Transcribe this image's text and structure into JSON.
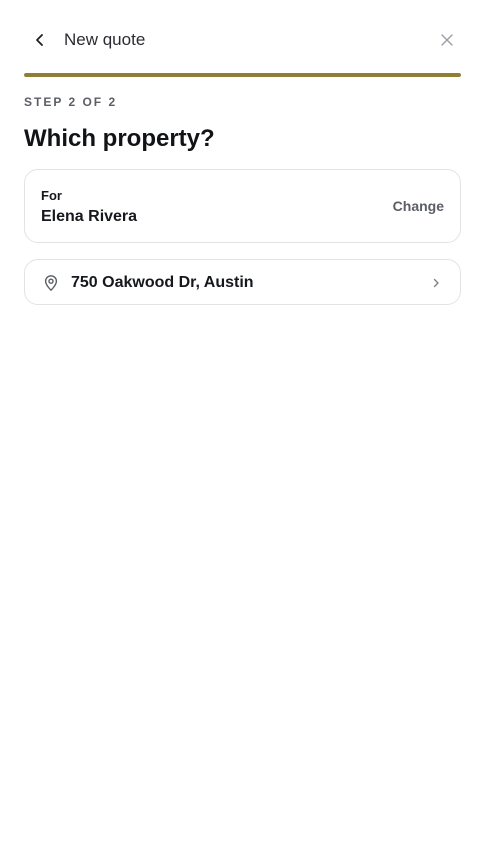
{
  "header": {
    "title": "New quote"
  },
  "progress": {
    "fraction": 1.0,
    "color": "#8f7f35",
    "track_color": "#e9e6da"
  },
  "step": {
    "label": "STEP 2 OF 2"
  },
  "page": {
    "title": "Which property?"
  },
  "for_card": {
    "label": "For",
    "name": "Elena Rivera",
    "change_label": "Change"
  },
  "property": {
    "address": "750 Oakwood Dr, Austin",
    "icon": "map-pin-icon"
  },
  "icons": {
    "back": "chevron-left-icon",
    "close": "close-icon",
    "row_chevron": "chevron-right-icon"
  }
}
